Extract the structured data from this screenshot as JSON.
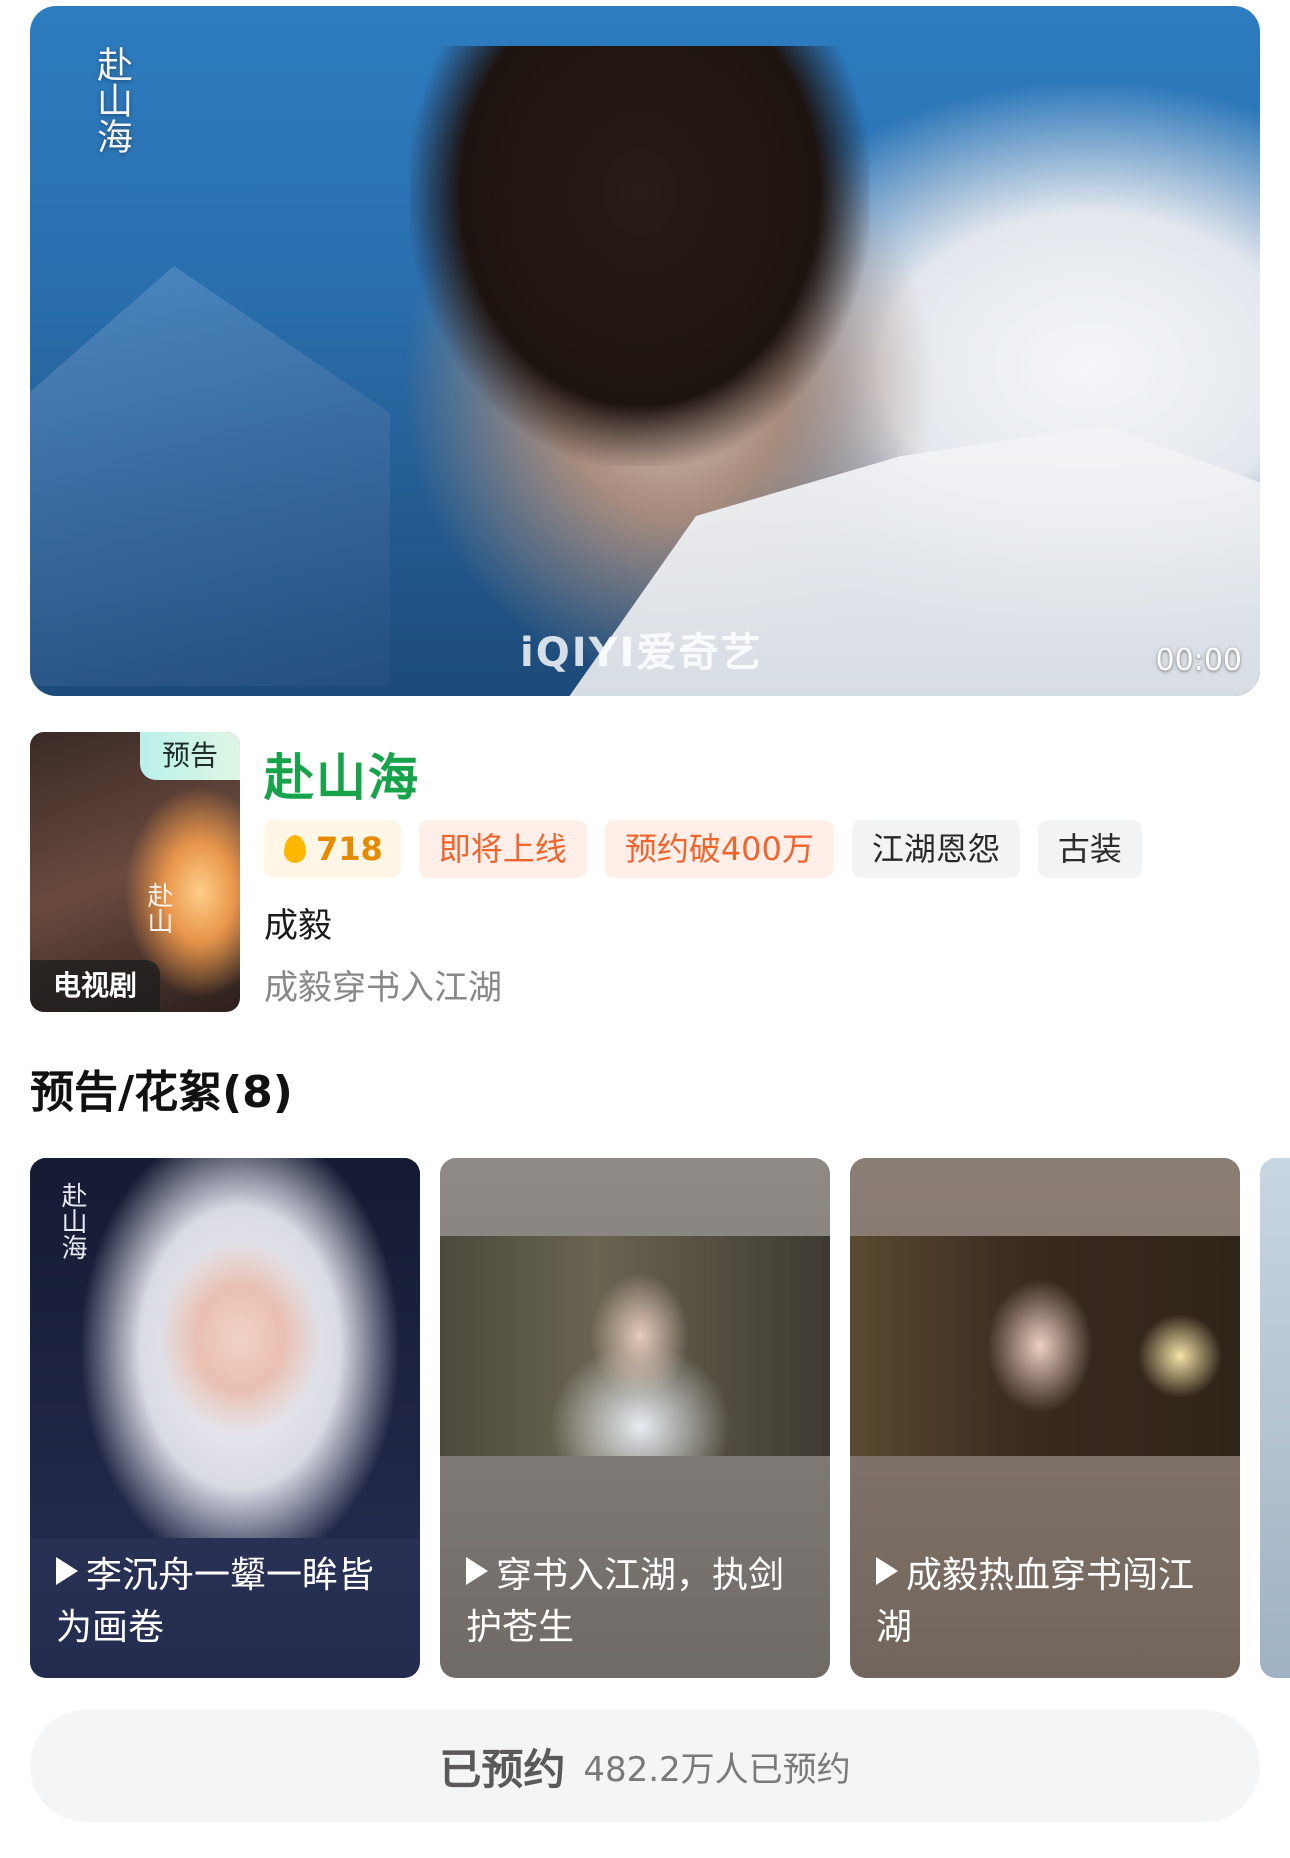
{
  "player": {
    "logo_text": "赴山海",
    "watermark": "iQIYI爱奇艺",
    "time": "00:00"
  },
  "show": {
    "poster_badge": "预告",
    "poster_type": "电视剧",
    "poster_logo": "赴山",
    "title": "赴山海",
    "hot_score": "718",
    "tags": [
      "即将上线",
      "预约破400万",
      "江湖恩怨",
      "古装"
    ],
    "cast": "成毅",
    "description": "成毅穿书入江湖"
  },
  "section": {
    "title": "预告/花絮(8)"
  },
  "clips": [
    {
      "logo": "赴山海",
      "caption": "李沉舟一颦一眸皆为画卷"
    },
    {
      "caption": "穿书入江湖，执剑护苍生"
    },
    {
      "caption": "成毅热血穿书闯江湖"
    }
  ],
  "reserve": {
    "status": "已预约",
    "count_text": "482.2万人已预约"
  },
  "colors": {
    "title_green": "#16a34a",
    "hot_orange": "#e68a00",
    "tag_orange": "#f0642e"
  }
}
